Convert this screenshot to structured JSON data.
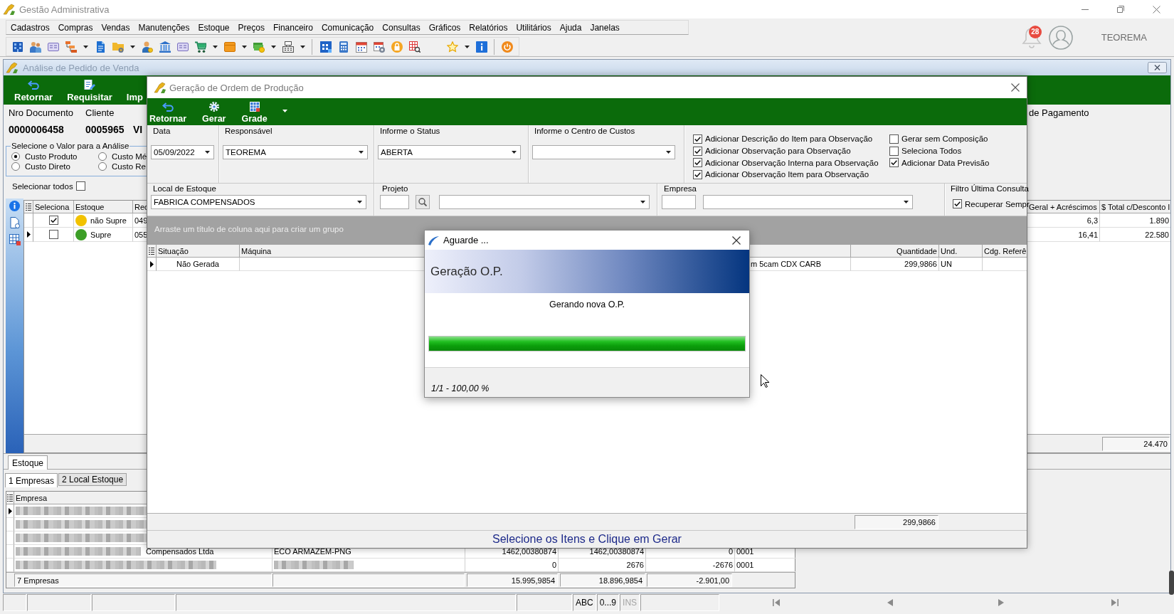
{
  "window": {
    "title": "Gestão Administrativa"
  },
  "menu_bar": [
    "Cadastros",
    "Compras",
    "Vendas",
    "Manutenções",
    "Estoque",
    "Preços",
    "Financeiro",
    "Comunicação",
    "Consultas",
    "Gráficos",
    "Relatórios",
    "Utilitários",
    "Ajuda",
    "Janelas"
  ],
  "user_area": {
    "notification_count": "28",
    "user_name": "TEOREMA"
  },
  "sales_window": {
    "title": "Análise de Pedido de Venda",
    "toolbar": [
      "Retornar",
      "Requisitar",
      "Imp"
    ],
    "header_fields": [
      {
        "label": "Nro Documento",
        "value": "0000006458"
      },
      {
        "label": "Cliente",
        "value": "0005965"
      },
      {
        "value": "VI"
      }
    ],
    "payment_label": "de Pagamento",
    "analysis_group": {
      "title": "Selecione o Valor para a Análise",
      "options": [
        {
          "label": "Custo Produto",
          "selected": true
        },
        {
          "label": "Custo Mé",
          "selected": false
        },
        {
          "label": "Custo Direto",
          "selected": false
        },
        {
          "label": "Custo Re",
          "selected": false
        }
      ]
    },
    "select_all": {
      "label": "Selecionar todos",
      "checked": false
    },
    "grid": {
      "columns": [
        "Seleciona",
        "Estoque",
        "Rec",
        "Geral + Acréscimos",
        "$ Total c/Desconto I"
      ],
      "rows": [
        {
          "current": false,
          "checked": true,
          "color": "#f2c200",
          "estoque": "não Supre",
          "column_3": "049",
          "geral_acrescimos": "6,3",
          "total_c_desconto": "1.890"
        },
        {
          "current": true,
          "checked": false,
          "color": "#3c9e26",
          "estoque": "Supre",
          "column_3": "055",
          "geral_acrescimos": "16,41",
          "total_c_desconto": "22.580"
        }
      ],
      "footer_total": "24.470"
    },
    "stock_tabs": [
      {
        "label": "Estoque",
        "selected": true
      }
    ],
    "stock_subtabs": [
      {
        "label": "1 Empresas",
        "selected": true
      },
      {
        "label": "2 Local Estoque",
        "selected": false
      }
    ],
    "companies_grid": {
      "columns": [
        "Empresa"
      ],
      "rows": [
        {
          "current": true,
          "empresa": {
            "kind": "blurred"
          }
        },
        {
          "current": false,
          "empresa": {
            "kind": "blurred"
          }
        },
        {
          "current": false,
          "empresa": {
            "kind": "blurred"
          }
        },
        {
          "current": false,
          "empresa": {
            "kind": "blurred",
            "text": "Compensados Ltda"
          },
          "column_2": {
            "kind": "text",
            "text": "ECO ARMAZEM-PNG"
          },
          "column_3": "1462,00380874",
          "column_4": "1462,00380874",
          "column_5": "0",
          "column_6": "0001"
        },
        {
          "current": false,
          "empresa": {
            "kind": "blurred"
          },
          "column_2": {
            "kind": "blurred"
          },
          "column_3": "0",
          "column_4": "2676",
          "column_5": "-2676",
          "column_6": "0001"
        }
      ],
      "footer": {
        "count": "7 Empresas",
        "column_3": "15.995,9854",
        "column_4": "18.896,9854",
        "column_5": "-2.901,00"
      }
    }
  },
  "production_dialog": {
    "title": "Geração de Ordem de Produção",
    "toolbar": [
      "Retornar",
      "Gerar",
      "Grade"
    ],
    "fields": {
      "data": {
        "label": "Data",
        "value": "05/09/2022"
      },
      "responsavel": {
        "label": "Responsável",
        "value": "TEOREMA"
      },
      "status": {
        "label": "Informe o Status",
        "value": "ABERTA"
      },
      "centro_custos": {
        "label": "Informe o Centro de Custos"
      },
      "local_estoque": {
        "label": "Local de Estoque",
        "value": "FABRICA COMPENSADOS"
      },
      "projeto": {
        "label": "Projeto"
      },
      "empresa": {
        "label": "Empresa"
      }
    },
    "options": [
      {
        "label": "Adicionar Descrição do Item para Observação",
        "checked": true
      },
      {
        "label": "Adicionar Observação para Observação",
        "checked": true
      },
      {
        "label": "Adicionar Observação Interna para Observação",
        "checked": true
      },
      {
        "label": "Adicionar Observação Item para Observação",
        "checked": true
      },
      {
        "label": "Gerar sem Composição",
        "checked": false
      },
      {
        "label": "Seleciona Todos",
        "checked": false
      },
      {
        "label": "Adicionar Data Previsão",
        "checked": true
      }
    ],
    "last_query_filter": {
      "title": "Filtro Última Consulta",
      "label": "Recuperar Sempr",
      "checked": true
    },
    "group_hint": "Arraste um título de coluna aqui para criar um grupo",
    "grid": {
      "columns": [
        "Situação",
        "Máquina",
        "Quantidade",
        "Und.",
        "Cdg. Referê"
      ],
      "rows": [
        {
          "current": true,
          "situacao": "Não Gerada",
          "column_3": "m 5cam CDX CARB",
          "quantidade": "299,9866",
          "und": "UN"
        }
      ],
      "footer_total": "299,9866"
    },
    "hint": "Selecione os Itens e Clique em Gerar"
  },
  "progress_dialog": {
    "title": "Aguarde ...",
    "heading": "Geração O.P.",
    "message": "Gerando nova O.P.",
    "level": 1,
    "status": "1/1 - 100,00 %"
  },
  "status_bar": {
    "panels": [
      {
        "label": "ABC",
        "disabled": false
      },
      {
        "label": "0...9",
        "disabled": false
      },
      {
        "label": "INS",
        "disabled": true
      }
    ]
  }
}
